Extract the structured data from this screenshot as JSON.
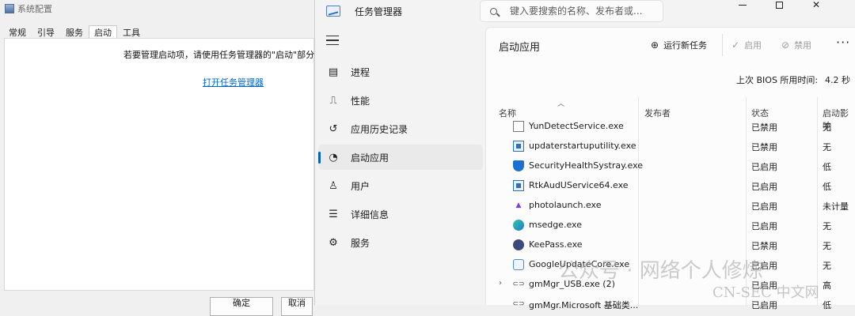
{
  "msconfig": {
    "title": "系统配置",
    "tabs": [
      "常规",
      "引导",
      "服务",
      "启动",
      "工具"
    ],
    "active_tab": 3,
    "message": "若要管理启动项，请使用任务管理器的\"启动\"部分。",
    "link": "打开任务管理器",
    "buttons": [
      "确定",
      "取消"
    ]
  },
  "taskmgr": {
    "title": "任务管理器",
    "search_placeholder": "键入要搜索的名称、发布者或...",
    "nav": [
      {
        "label": "进程",
        "icon": "processes-icon"
      },
      {
        "label": "性能",
        "icon": "performance-icon"
      },
      {
        "label": "应用历史记录",
        "icon": "app-history-icon"
      },
      {
        "label": "启动应用",
        "icon": "startup-apps-icon"
      },
      {
        "label": "用户",
        "icon": "users-icon"
      },
      {
        "label": "详细信息",
        "icon": "details-icon"
      },
      {
        "label": "服务",
        "icon": "services-icon"
      }
    ],
    "active_nav": 3,
    "page_title": "启动应用",
    "toolbar": {
      "run_new_task": "运行新任务",
      "enable": "启用",
      "disable": "禁用"
    },
    "bios_label": "上次 BIOS 所用时间:",
    "bios_value": "4.2 秒",
    "columns": {
      "name": "名称",
      "publisher": "发布者",
      "status": "状态",
      "impact": "启动影响"
    },
    "rows": [
      {
        "name": "YunDetectService.exe",
        "status": "已禁用",
        "impact": "无",
        "icon": "doc-icon"
      },
      {
        "name": "updaterstartuputility.exe",
        "status": "已禁用",
        "impact": "无",
        "icon": "app-icon"
      },
      {
        "name": "SecurityHealthSystray.exe",
        "status": "已启用",
        "impact": "低",
        "icon": "shield-icon"
      },
      {
        "name": "RtkAudUService64.exe",
        "status": "已启用",
        "impact": "低",
        "icon": "app-icon"
      },
      {
        "name": "photolaunch.exe",
        "status": "已启用",
        "impact": "未计量",
        "icon": "photo-icon"
      },
      {
        "name": "msedge.exe",
        "status": "已启用",
        "impact": "无",
        "icon": "edge-icon"
      },
      {
        "name": "KeePass.exe",
        "status": "已禁用",
        "impact": "无",
        "icon": "keepass-icon"
      },
      {
        "name": "GoogleUpdateCore.exe",
        "status": "已启用",
        "impact": "无",
        "icon": "google-update-icon"
      },
      {
        "name": "gmMgr_USB.exe (2)",
        "status": "已启用",
        "impact": "高",
        "icon": "link-icon",
        "expandable": true
      },
      {
        "name": "gmMgr.Microsoft 基础类...",
        "status": "已启用",
        "impact": "低",
        "icon": "link-icon"
      }
    ]
  },
  "watermark": {
    "text": "公众号 · 网络个人修炼",
    "site": "CN-SEC 中文网"
  }
}
